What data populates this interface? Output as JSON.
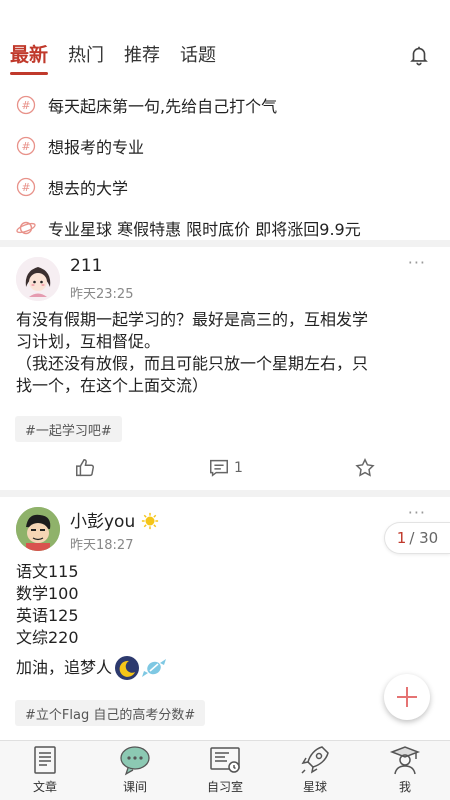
{
  "header": {
    "tabs": [
      {
        "label": "最新",
        "active": true
      },
      {
        "label": "热门",
        "active": false
      },
      {
        "label": "推荐",
        "active": false
      },
      {
        "label": "话题",
        "active": false
      }
    ],
    "bell_icon": "bell-icon"
  },
  "topics": [
    {
      "icon": "hashtag-icon",
      "label": "每天起床第一句,先给自己打个气"
    },
    {
      "icon": "hashtag-icon",
      "label": "想报考的专业"
    },
    {
      "icon": "hashtag-icon",
      "label": "想去的大学"
    },
    {
      "icon": "planet-icon",
      "label": "专业星球 寒假特惠 限时底价 即将涨回9.9元"
    }
  ],
  "posts": [
    {
      "username": "211",
      "time": "昨天23:25",
      "more": "···",
      "body": [
        "有没有假期一起学习的？最好是高三的，互相发学",
        "习计划，互相督促。",
        "（我还没有放假，而且可能只放一个星期左右，只",
        "找一个，在这个上面交流）"
      ],
      "tag": "#一起学习吧#",
      "comment_count": "1"
    },
    {
      "username": "小彭you",
      "time": "昨天18:27",
      "more": "···",
      "body": [
        "语文115",
        "数学100",
        "英语125",
        "文综220"
      ],
      "body2": "加油，追梦人",
      "tag": "#立个Flag 自己的高考分数#"
    }
  ],
  "pager": {
    "current": "1",
    "total": "/ 30"
  },
  "bottom_nav": [
    {
      "label": "文章",
      "icon": "article-icon"
    },
    {
      "label": "课间",
      "icon": "chat-bubble-icon"
    },
    {
      "label": "自习室",
      "icon": "study-room-icon"
    },
    {
      "label": "星球",
      "icon": "rocket-icon"
    },
    {
      "label": "我",
      "icon": "graduate-icon"
    }
  ],
  "colors": {
    "accent": "#c0392b",
    "divider": "#f2f2f2",
    "fab_plus": "#e57373"
  }
}
